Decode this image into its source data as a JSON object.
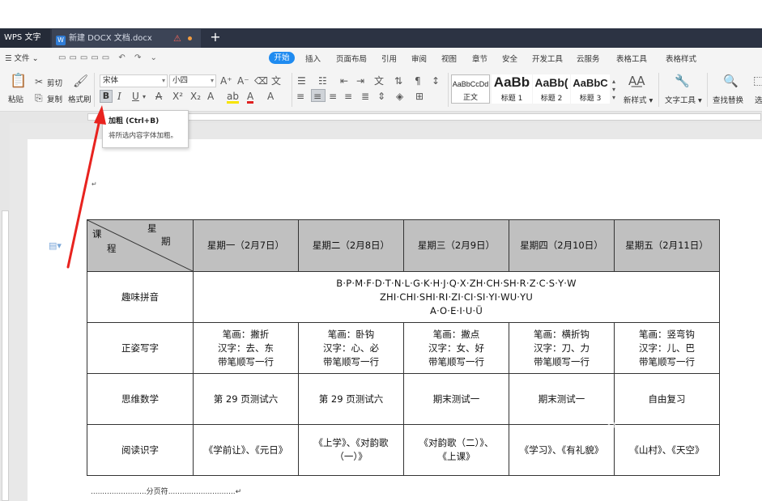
{
  "app": {
    "name": "WPS 文字",
    "doc_tab": "新建 DOCX 文档.docx"
  },
  "menu": {
    "file": "文件",
    "tabs": [
      "开始",
      "插入",
      "页面布局",
      "引用",
      "审阅",
      "视图",
      "章节",
      "安全",
      "开发工具",
      "云服务",
      "表格工具",
      "表格样式"
    ]
  },
  "ribbon": {
    "paste": "粘贴",
    "cut": "剪切",
    "copy": "复制",
    "format_painter": "格式刷",
    "font_name": "宋体",
    "font_size": "小四",
    "styles": [
      {
        "preview": "AaBbCcDd",
        "label": "正文"
      },
      {
        "preview": "AaBb",
        "label": "标题 1"
      },
      {
        "preview": "AaBb(",
        "label": "标题 2"
      },
      {
        "preview": "AaBbC",
        "label": "标题 3"
      }
    ],
    "new_style": "新样式",
    "text_tools": "文字工具",
    "find_replace": "查找替换",
    "select": "选"
  },
  "tooltip": {
    "title": "加粗 (Ctrl+B)",
    "desc": "将所选内容字体加粗。"
  },
  "table": {
    "corner": {
      "course": "课",
      "course2": "程",
      "week": "星",
      "week2": "期"
    },
    "headers": [
      "星期一（2月7日）",
      "星期二（2月8日）",
      "星期三（2月9日）",
      "星期四（2月10日）",
      "星期五（2月11日）"
    ],
    "rows": [
      {
        "subject": "趣味拼音",
        "merged_lines": [
          "B·P·M·F·D·T·N·L·G·K·H·J·Q·X·ZH·CH·SH·R·Z·C·S·Y·W",
          "ZHI·CHI·SHI·RI·ZI·CI·SI·YI·WU·YU",
          "A·O·E·I·U·Ü"
        ]
      },
      {
        "subject": "正姿写字",
        "cells": [
          [
            "笔画：撇折",
            "汉字：去、东",
            "带笔顺写一行"
          ],
          [
            "笔画：卧钩",
            "汉字：心、必",
            "带笔顺写一行"
          ],
          [
            "笔画：撇点",
            "汉字：女、好",
            "带笔顺写一行"
          ],
          [
            "笔画：横折钩",
            "汉字：刀、力",
            "带笔顺写一行"
          ],
          [
            "笔画：竖弯钩",
            "汉字：儿、巴",
            "带笔顺写一行"
          ]
        ]
      },
      {
        "subject": "思维数学",
        "cells": [
          "第 29 页测试六",
          "第 29 页测试六",
          "期末测试一",
          "期末测试一",
          "自由复习"
        ]
      },
      {
        "subject": "阅读识字",
        "cells": [
          [
            "《学前让》、《元日》"
          ],
          [
            "《上学》、《对韵歌",
            "（一）》"
          ],
          [
            "《对韵歌（二）》、",
            "《上课》"
          ],
          [
            "《学习》、《有礼貌》"
          ],
          [
            "《山村》、《天空》"
          ]
        ]
      }
    ]
  },
  "page_break": "分页符",
  "colors": {
    "accent": "#1f8bf0",
    "tabbar": "#2c3343",
    "arrow": "#e8231f"
  }
}
